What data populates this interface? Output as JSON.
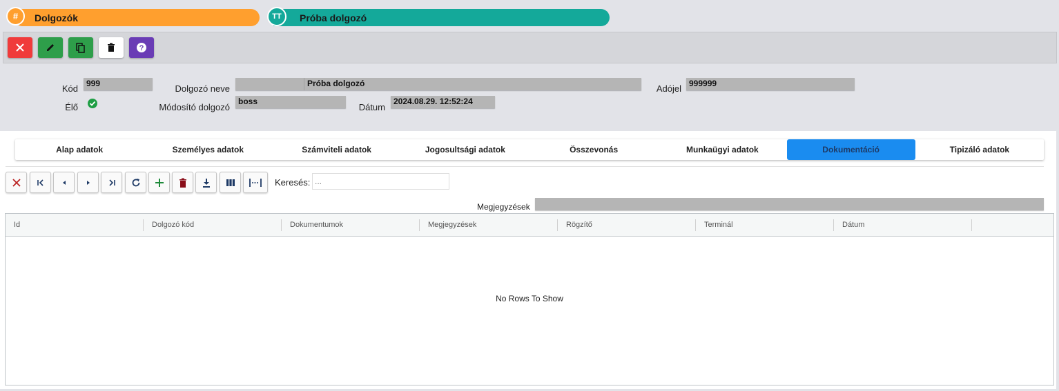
{
  "header": {
    "pill1": {
      "label": "Dolgozók",
      "icon": "#"
    },
    "pill2": {
      "label": "Próba dolgozó",
      "icon": "TT"
    }
  },
  "toolbar": {
    "colors": {
      "close": "#f03b3b",
      "edit": "#2e9e4a",
      "copy": "#2e9e4a",
      "delete": "#ffffff",
      "help": "#6a3cb5"
    }
  },
  "form": {
    "kod_label": "Kód",
    "kod_value": "999",
    "elo_label": "Élő",
    "dolgozo_neve_label": "Dolgozó neve",
    "dolgozo_neve_value": "Próba dolgozó",
    "adojel_label": "Adójel",
    "adojel_value": "999999",
    "modosito_label": "Módosító dolgozó",
    "modosito_value": "boss",
    "datum_label": "Dátum",
    "datum_value": "2024.08.29. 12:52:24"
  },
  "tabs": [
    {
      "label": "Alap adatok"
    },
    {
      "label": "Személyes adatok"
    },
    {
      "label": "Számviteli adatok"
    },
    {
      "label": "Jogosultsági adatok"
    },
    {
      "label": "Összevonás"
    },
    {
      "label": "Munkaügyi adatok"
    },
    {
      "label": "Dokumentáció",
      "active": true
    },
    {
      "label": "Tipizáló adatok"
    }
  ],
  "search": {
    "label": "Keresés:",
    "placeholder": "..."
  },
  "megjegyzesek_label": "Megjegyzések",
  "grid": {
    "columns": [
      "Id",
      "Dolgozó kód",
      "Dokumentumok",
      "Megjegyzések",
      "Rögzítő",
      "Terminál",
      "Dátum"
    ],
    "empty_text": "No Rows To Show"
  },
  "accent": "#1a8cf0"
}
